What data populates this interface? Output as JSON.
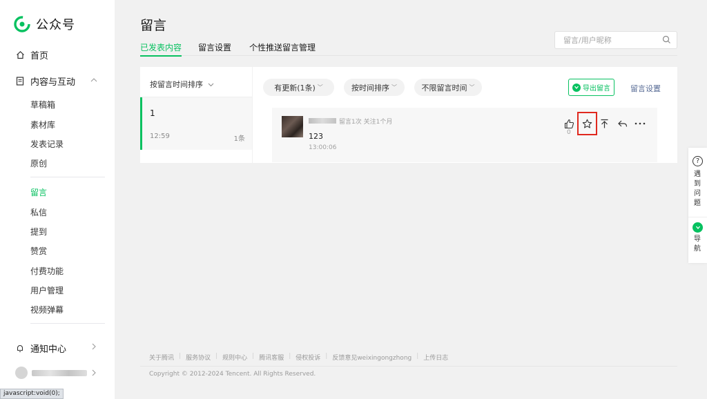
{
  "brand": {
    "name": "公众号",
    "color": "#07c160"
  },
  "sidebar": {
    "home": "首页",
    "content_group": "内容与互动",
    "content_items": [
      "草稿箱",
      "素材库",
      "发表记录",
      "原创"
    ],
    "interaction_items": [
      "留言",
      "私信",
      "提到",
      "赞赏",
      "付费功能",
      "用户管理",
      "视频弹幕"
    ],
    "active_item": "留言",
    "notifications": "通知中心"
  },
  "status_bar": "javascript:void(0);",
  "header": {
    "title": "留言",
    "tabs": [
      "已发表内容",
      "留言设置",
      "个性推送留言管理"
    ],
    "active_tab": "已发表内容",
    "search_placeholder": "留言/用户昵称"
  },
  "left_panel": {
    "sort_label": "按留言时间排序",
    "article": {
      "title": "1",
      "time": "12:59",
      "count": "1条"
    }
  },
  "filters": {
    "updated": "有更新(1条)",
    "sort": "按时间排序",
    "time_range": "不限留言时间",
    "export": "导出留言",
    "settings": "留言设置"
  },
  "comment": {
    "meta": "留言1次 关注1个月",
    "text": "123",
    "time": "13:00:06",
    "like_count": "0",
    "actions": [
      "like-icon",
      "star-icon",
      "pin-top-icon",
      "reply-icon",
      "more-icon"
    ]
  },
  "footer": {
    "links": [
      "关于腾讯",
      "服务协议",
      "规则中心",
      "腾讯客服",
      "侵权投诉",
      "反馈意见weixingongzhong",
      "上传日志"
    ],
    "copyright": "Copyright © 2012-2024 Tencent. All Rights Reserved."
  },
  "float_help": {
    "problem": "遇到问题",
    "nav": "导航"
  }
}
